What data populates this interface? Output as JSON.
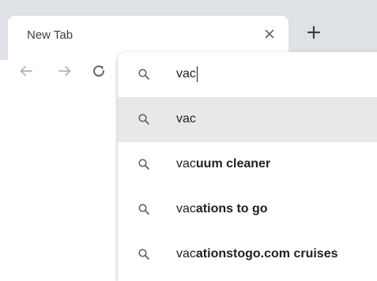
{
  "tab": {
    "title": "New Tab",
    "close_icon": "close-icon",
    "new_tab_icon": "plus-icon"
  },
  "nav": {
    "back_icon": "arrow-left-icon",
    "forward_icon": "arrow-right-icon",
    "reload_icon": "reload-icon"
  },
  "omnibox": {
    "value": "vac",
    "icon": "search-icon"
  },
  "suggestions": [
    {
      "typed": "vac",
      "completion": "",
      "selected": true
    },
    {
      "typed": "vac",
      "completion": "uum cleaner",
      "selected": false
    },
    {
      "typed": "vac",
      "completion": "ations to go",
      "selected": false
    },
    {
      "typed": "vac",
      "completion": "ationstogo.com cruises",
      "selected": false
    }
  ],
  "colors": {
    "tabstrip": "#dee1e6",
    "selected_row": "#e8e8e9",
    "icon": "#5f6368"
  }
}
